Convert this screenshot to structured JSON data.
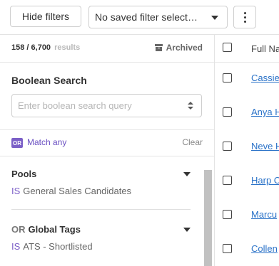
{
  "toolbar": {
    "hide_filters_label": "Hide filters",
    "saved_filter_value": "No saved filter select…",
    "more_icon": "kebab-vertical-icon"
  },
  "sidebar": {
    "result_count": "158 / 6,700",
    "result_suffix": "results",
    "archived_label": "Archived",
    "boolean_title": "Boolean Search",
    "boolean_placeholder": "Enter boolean search query",
    "match_badge": "OR",
    "match_label": "Match any",
    "clear_label": "Clear",
    "filters": [
      {
        "prefix": "",
        "title": "Pools",
        "operator": "IS",
        "value": "General Sales Candidates"
      },
      {
        "prefix": "OR",
        "title": "Global Tags",
        "operator": "IS",
        "value": "ATS - Shortlisted"
      }
    ]
  },
  "table": {
    "header": "Full Na",
    "rows": [
      "Cassie",
      "Anya H",
      "Neve H",
      "Harp C",
      "Marcu",
      "Collen"
    ]
  },
  "colors": {
    "accent_purple": "#7b5fc7",
    "link_blue": "#2a72c8",
    "border": "#cfcfcf"
  }
}
